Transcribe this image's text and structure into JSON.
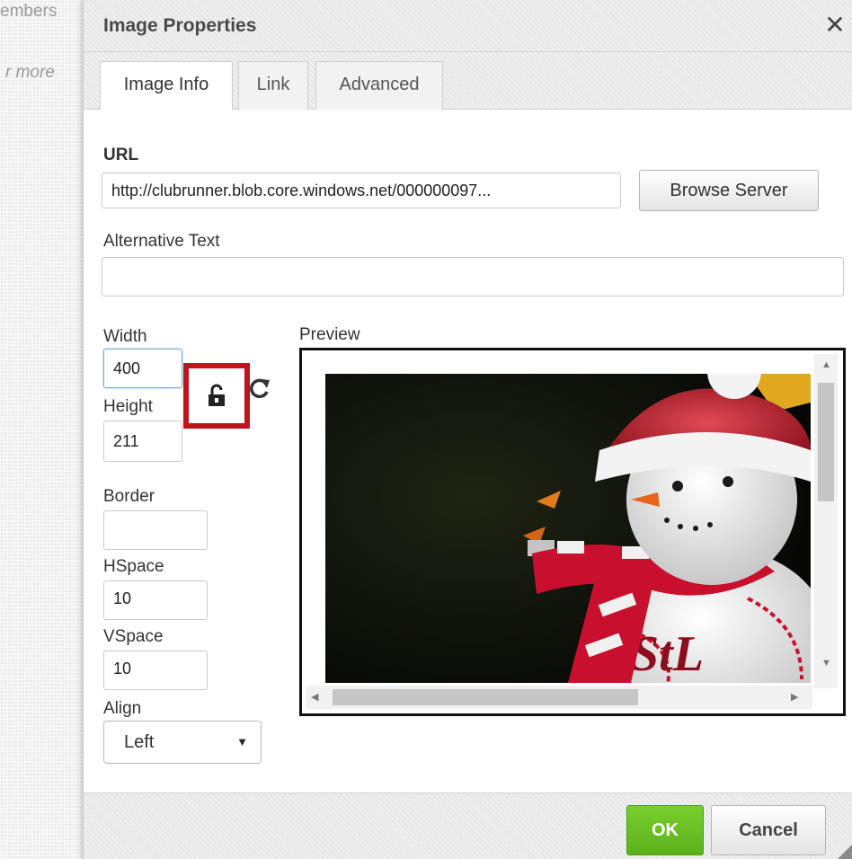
{
  "background": {
    "members_fragment": "embers",
    "more_fragment": "r more"
  },
  "dialog": {
    "title": "Image Properties",
    "close_glyph": "✕",
    "tabs": [
      {
        "label": "Image Info",
        "active": true
      },
      {
        "label": "Link",
        "active": false
      },
      {
        "label": "Advanced",
        "active": false
      }
    ],
    "url": {
      "label": "URL",
      "value": "http://clubrunner.blob.core.windows.net/000000097..."
    },
    "browse_button": "Browse Server",
    "alt_text": {
      "label": "Alternative Text",
      "value": ""
    },
    "width": {
      "label": "Width",
      "value": "400"
    },
    "height": {
      "label": "Height",
      "value": "211"
    },
    "lock_icon": "unlock-icon",
    "reset_icon": "reset-size-icon",
    "border": {
      "label": "Border",
      "value": ""
    },
    "hspace": {
      "label": "HSpace",
      "value": "10"
    },
    "vspace": {
      "label": "VSpace",
      "value": "10"
    },
    "align": {
      "label": "Align",
      "value": "Left"
    },
    "preview": {
      "label": "Preview",
      "image": "snowman-ornament"
    },
    "ok_button": "OK",
    "cancel_button": "Cancel",
    "colors": {
      "highlight_border": "#c0131b",
      "ok_green": "#5bb11b"
    }
  }
}
